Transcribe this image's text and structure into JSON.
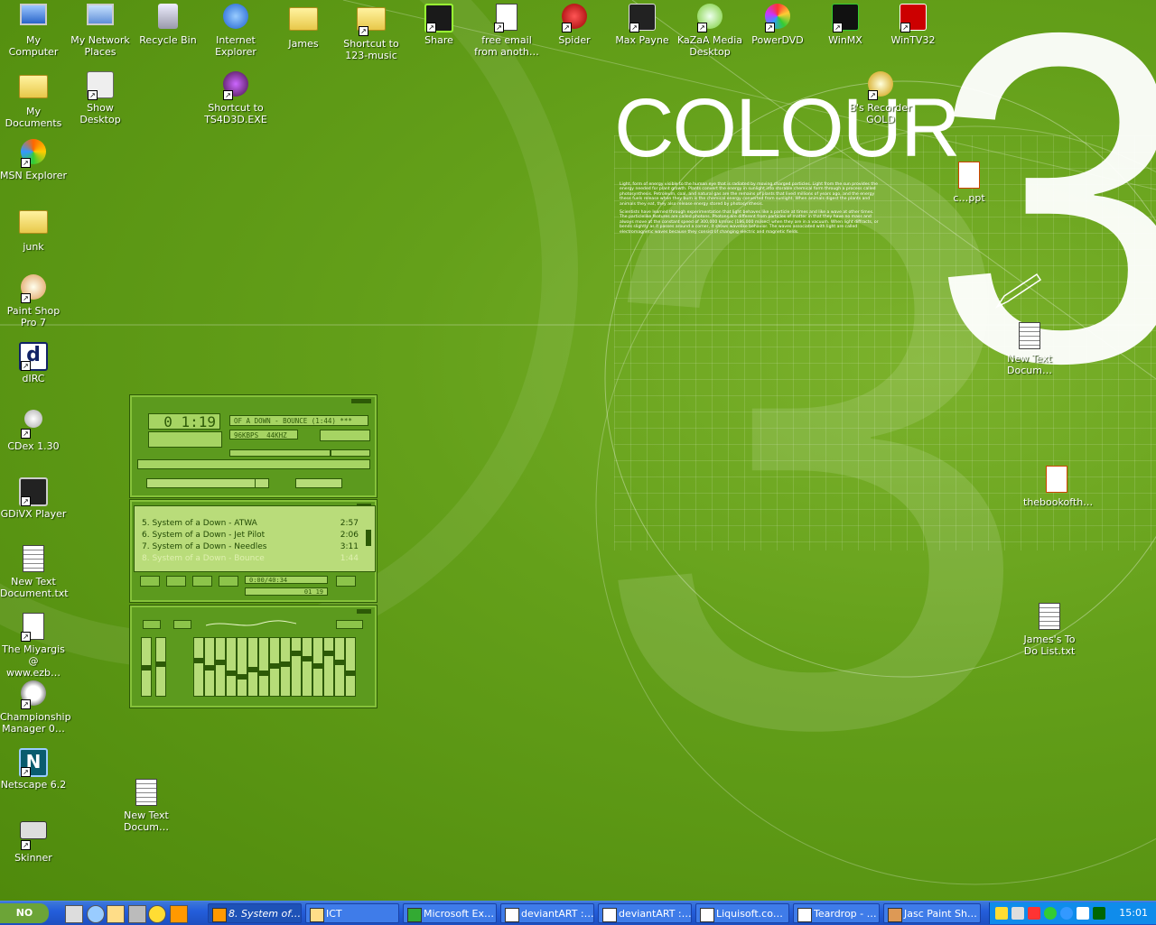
{
  "desktop": {
    "icons": [
      {
        "id": "my-computer",
        "label": "My Computer"
      },
      {
        "id": "my-network-places",
        "label": "My Network Places"
      },
      {
        "id": "recycle-bin",
        "label": "Recycle Bin"
      },
      {
        "id": "internet-explorer",
        "label": "Internet Explorer"
      },
      {
        "id": "james",
        "label": "James"
      },
      {
        "id": "shortcut-123-music",
        "label": "Shortcut to 123-music"
      },
      {
        "id": "share",
        "label": "Share"
      },
      {
        "id": "free-email",
        "label": "free email from anoth…"
      },
      {
        "id": "spider",
        "label": "Spider"
      },
      {
        "id": "max-payne",
        "label": "Max Payne"
      },
      {
        "id": "kazaa",
        "label": "KaZaA Media Desktop"
      },
      {
        "id": "powerdvd",
        "label": "PowerDVD"
      },
      {
        "id": "winmx",
        "label": "WinMX"
      },
      {
        "id": "wintv32",
        "label": "WinTV32"
      },
      {
        "id": "my-documents",
        "label": "My Documents"
      },
      {
        "id": "show-desktop",
        "label": "Show Desktop"
      },
      {
        "id": "shortcut-ts4d3d",
        "label": "Shortcut to TS4D3D.EXE"
      },
      {
        "id": "bs-recorder",
        "label": "B's Recorder GOLD"
      },
      {
        "id": "msn-explorer",
        "label": "MSN Explorer"
      },
      {
        "id": "junk",
        "label": "junk"
      },
      {
        "id": "paint-shop-pro",
        "label": "Paint Shop Pro 7"
      },
      {
        "id": "dirc",
        "label": "dIRC"
      },
      {
        "id": "cdex",
        "label": "CDex 1.30"
      },
      {
        "id": "gdivx",
        "label": "GDiVX Player"
      },
      {
        "id": "new-text-document",
        "label": "New Text Document.txt"
      },
      {
        "id": "miyargis",
        "label": "The Miyargis @ www.ezb…"
      },
      {
        "id": "championship-manager",
        "label": "Championship Manager 0…"
      },
      {
        "id": "netscape",
        "label": "Netscape 6.2"
      },
      {
        "id": "skinner",
        "label": "Skinner"
      },
      {
        "id": "new-text-docum-2",
        "label": "New Text Docum…"
      },
      {
        "id": "ppt-file",
        "label": "c…ppt"
      },
      {
        "id": "new-text-docum-3",
        "label": "New Text Docum…"
      },
      {
        "id": "thebookofth",
        "label": "thebookofth…"
      },
      {
        "id": "james-todo",
        "label": "James's To Do List.txt"
      }
    ],
    "wallpaper": {
      "title": "COLOUR",
      "numeral": "3",
      "paragraph1": "Light, form of energy visible to the human eye that is radiated by moving charged particles. Light from the sun provides the energy needed for plant growth. Plants convert the energy in sunlight into storable chemical form through a process called photosynthesis. Petroleum, coal, and natural gas are the remains of plants that lived millions of years ago, and the energy these fuels release when they burn is the chemical energy converted from sunlight. When animals digest the plants and animals they eat, they also release energy stored by photosynthesis.",
      "paragraph2": "Scientists have learned through experimentation that light behaves like a particle at times and like a wave at other times. The particlelike features are called photons. Photons are different from particles of matter in that they have no mass and always move at the constant speed of 300,000 km/sec (186,000 mi/sec) when they are in a vacuum. When light diffracts, or bends slightly as it passes around a corner, it shows wavelike behavior. The waves associated with light are called electromagnetic waves because they consist of changing electric and magnetic fields."
    }
  },
  "winamp": {
    "time": "0 1:19",
    "track_title": "OF A DOWN - BOUNCE (1:44)",
    "marquee_suffix": "***",
    "kbps": "96",
    "kbps_label": "KBPS",
    "khz": "44",
    "khz_label": "KHZ",
    "playlist": [
      {
        "title": "5. System of a Down - ATWA",
        "length": "2:57"
      },
      {
        "title": "6. System of a Down - Jet Pilot",
        "length": "2:06"
      },
      {
        "title": "7. System of a Down - Needles",
        "length": "3:11"
      },
      {
        "title": "8. System of a Down - Bounce",
        "length": "1:44"
      }
    ],
    "playlist_time": "0:00/40:34",
    "playlist_mini_time": "01 19"
  },
  "taskbar": {
    "start_label": "NO",
    "tasks": [
      {
        "label": "8. System of…",
        "active": true
      },
      {
        "label": "ICT",
        "active": false
      },
      {
        "label": "Microsoft Ex…",
        "active": false
      },
      {
        "label": "deviantART :…",
        "active": false
      },
      {
        "label": "deviantART :…",
        "active": false
      },
      {
        "label": "Liquisoft.co…",
        "active": false
      },
      {
        "label": "Teardrop - …",
        "active": false
      },
      {
        "label": "Jasc Paint Sh…",
        "active": false
      }
    ],
    "clock": "15:01"
  },
  "colors": {
    "desktop_green": "#5a9412",
    "taskbar_blue": "#245edb",
    "tray_blue": "#0f8ceb",
    "winamp_green": "#5c9a1e"
  }
}
